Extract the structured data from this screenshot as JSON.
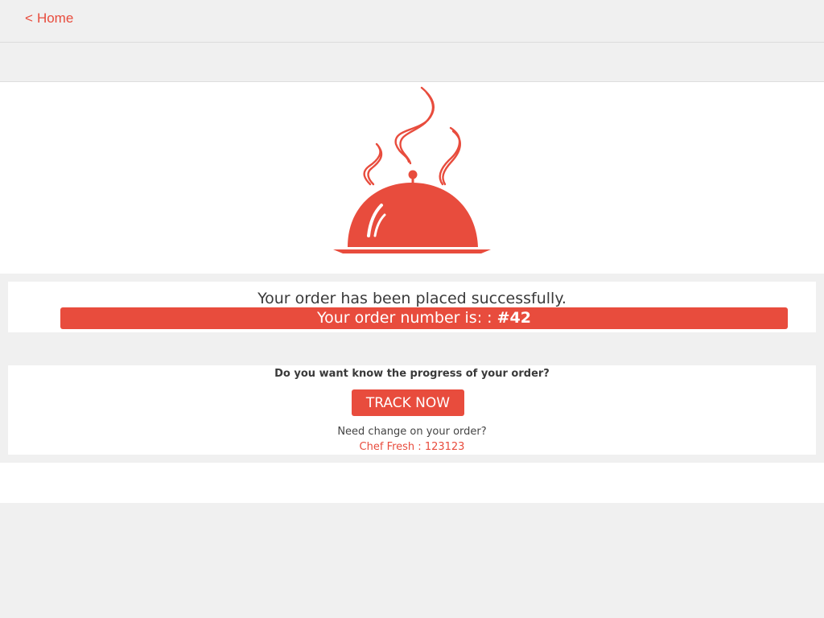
{
  "nav": {
    "back_chevron": "<",
    "home_label": "Home"
  },
  "hero": {
    "icon": "food-cloche-icon",
    "accent_color": "#e84c3d"
  },
  "order": {
    "success_message": "Your order has been placed successfully.",
    "number_label": "Your order number is: :",
    "number_value": "#42"
  },
  "tracking": {
    "question": "Do you want know the progress of your order?",
    "track_button_label": "TRACK NOW",
    "change_question": "Need change on your order?",
    "chef_contact": "Chef Fresh : 123123"
  }
}
